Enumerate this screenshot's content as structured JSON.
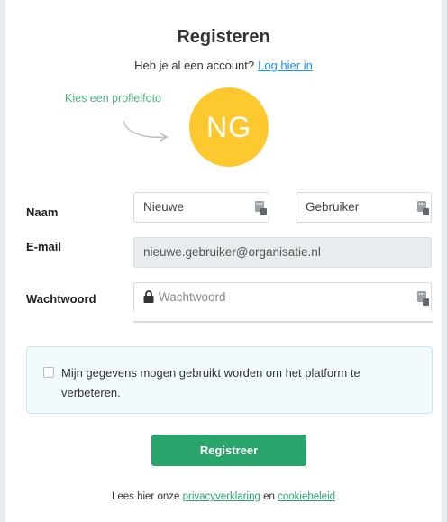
{
  "header": {
    "title": "Registeren",
    "have_account": "Heb je al een account?",
    "login_link": "Log hier in"
  },
  "profile": {
    "hint": "Kies een profielfoto",
    "initials": "NG",
    "avatar_color": "#fdc92f"
  },
  "form": {
    "name_label": "Naam",
    "first_name_value": "Nieuwe",
    "last_name_value": "Gebruiker",
    "email_label": "E-mail",
    "email_value": "nieuwe.gebruiker@organisatie.nl",
    "password_label": "Wachtwoord",
    "password_placeholder": "Wachtwoord"
  },
  "consent": {
    "checked": false,
    "text": "Mijn gegevens mogen gebruikt worden om het platform te verbeteren."
  },
  "submit_label": "Registreer",
  "footer": {
    "prefix": "Lees hier onze",
    "privacy_link": "privacyverklaring",
    "conjunction": "en",
    "cookie_link": "cookiebeleid"
  },
  "colors": {
    "accent_green": "#2aa56b",
    "link_blue": "#1e90ff"
  }
}
